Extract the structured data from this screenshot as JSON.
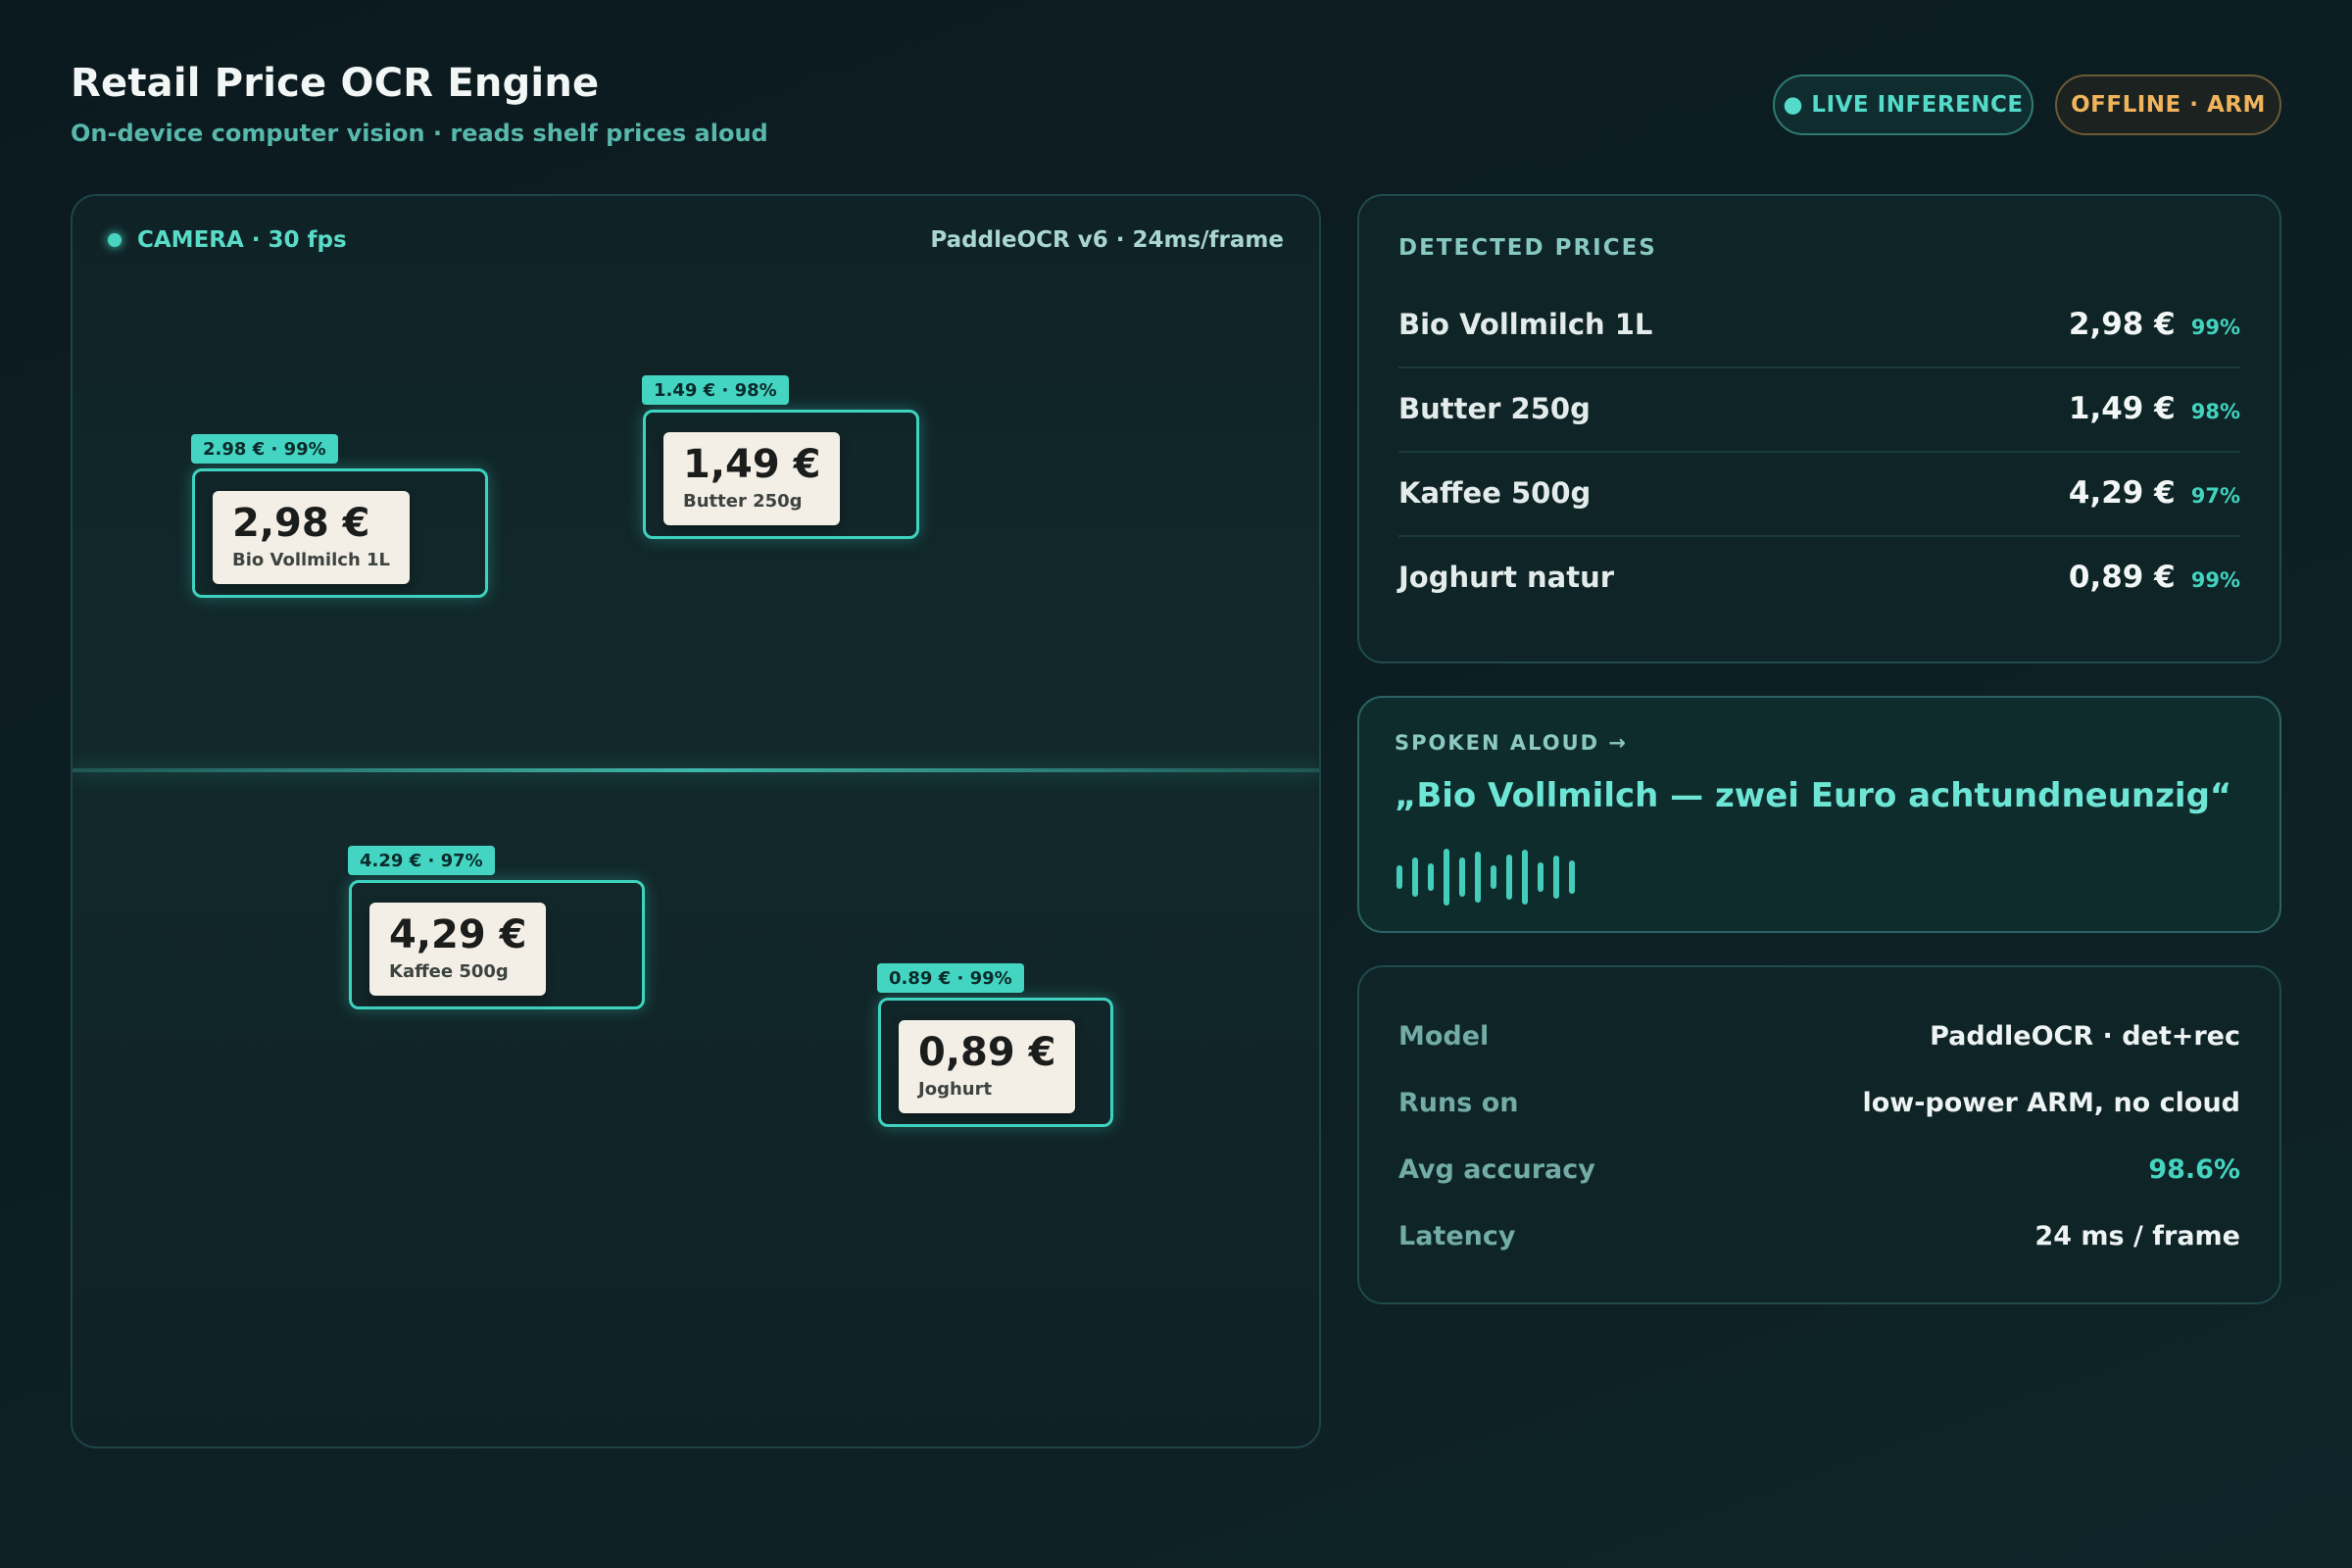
{
  "header": {
    "title": "Retail Price OCR Engine",
    "subtitle": "On-device computer vision · reads shelf prices aloud"
  },
  "badges": {
    "live": "● LIVE INFERENCE",
    "offline": "OFFLINE · ARM"
  },
  "camera": {
    "status": "CAMERA · 30 fps",
    "engine": "PaddleOCR v6 · 24ms/frame",
    "detections": [
      {
        "label": "2.98 € · 99%",
        "price": "2,98 €",
        "name": "Bio Vollmilch 1L"
      },
      {
        "label": "1.49 € · 98%",
        "price": "1,49 €",
        "name": "Butter 250g"
      },
      {
        "label": "4.29 € · 97%",
        "price": "4,29 €",
        "name": "Kaffee 500g"
      },
      {
        "label": "0.89 € · 99%",
        "price": "0,89 €",
        "name": "Joghurt"
      }
    ]
  },
  "detected": {
    "heading": "DETECTED PRICES",
    "items": [
      {
        "name": "Bio Vollmilch 1L",
        "price": "2,98 €",
        "confidence": "99%"
      },
      {
        "name": "Butter 250g",
        "price": "1,49 €",
        "confidence": "98%"
      },
      {
        "name": "Kaffee 500g",
        "price": "4,29 €",
        "confidence": "97%"
      },
      {
        "name": "Joghurt natur",
        "price": "0,89 €",
        "confidence": "99%"
      }
    ]
  },
  "spoken": {
    "heading": "SPOKEN ALOUD →",
    "text": "„Bio Vollmilch — zwei Euro achtundneunzig“"
  },
  "specs": [
    {
      "key": "Model",
      "value": "PaddleOCR · det+rec"
    },
    {
      "key": "Runs on",
      "value": "low-power ARM, no cloud"
    },
    {
      "key": "Avg accuracy",
      "value": "98.6%"
    },
    {
      "key": "Latency",
      "value": "24 ms / frame"
    }
  ],
  "colors": {
    "accent": "#45d4c0",
    "warning": "#f0b45c",
    "background": "#0d1f23"
  }
}
